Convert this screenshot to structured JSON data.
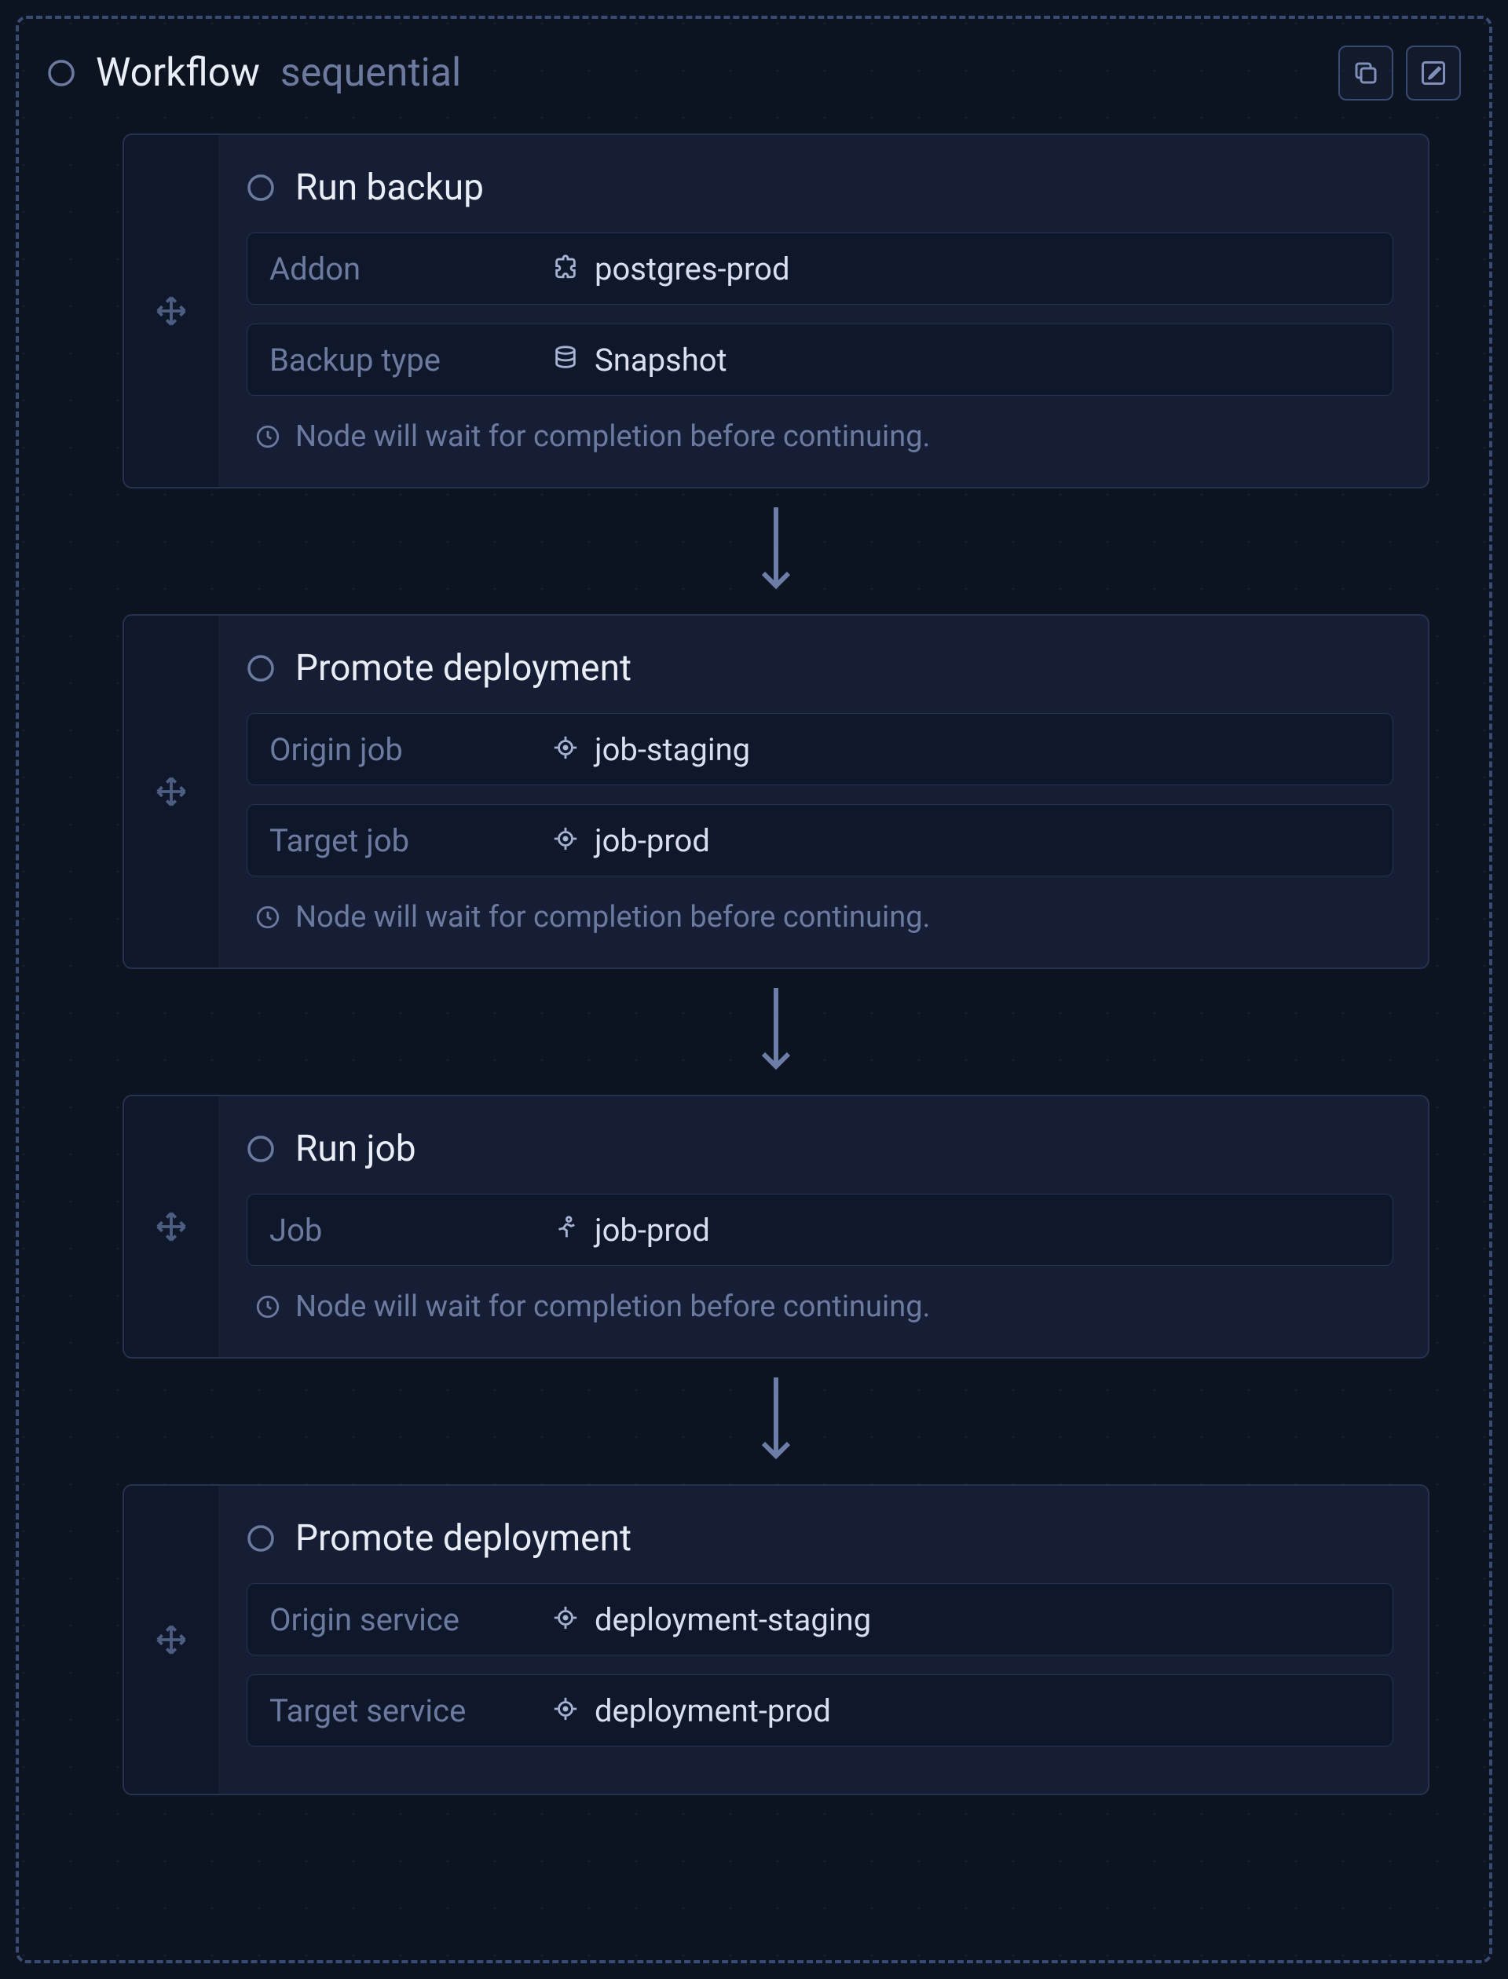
{
  "header": {
    "title": "Workflow",
    "type": "sequential"
  },
  "footer_text": "Node will wait for completion before continuing.",
  "nodes": [
    {
      "title": "Run backup",
      "has_footer": true,
      "fields": [
        {
          "label": "Addon",
          "icon": "puzzle",
          "value": "postgres-prod"
        },
        {
          "label": "Backup type",
          "icon": "database",
          "value": "Snapshot"
        }
      ]
    },
    {
      "title": "Promote deployment",
      "has_footer": true,
      "fields": [
        {
          "label": "Origin job",
          "icon": "target",
          "value": "job-staging"
        },
        {
          "label": "Target job",
          "icon": "target",
          "value": "job-prod"
        }
      ]
    },
    {
      "title": "Run job",
      "has_footer": true,
      "fields": [
        {
          "label": "Job",
          "icon": "runner",
          "value": "job-prod"
        }
      ]
    },
    {
      "title": "Promote deployment",
      "has_footer": false,
      "fields": [
        {
          "label": "Origin service",
          "icon": "target",
          "value": "deployment-staging"
        },
        {
          "label": "Target service",
          "icon": "target",
          "value": "deployment-prod"
        }
      ]
    }
  ]
}
